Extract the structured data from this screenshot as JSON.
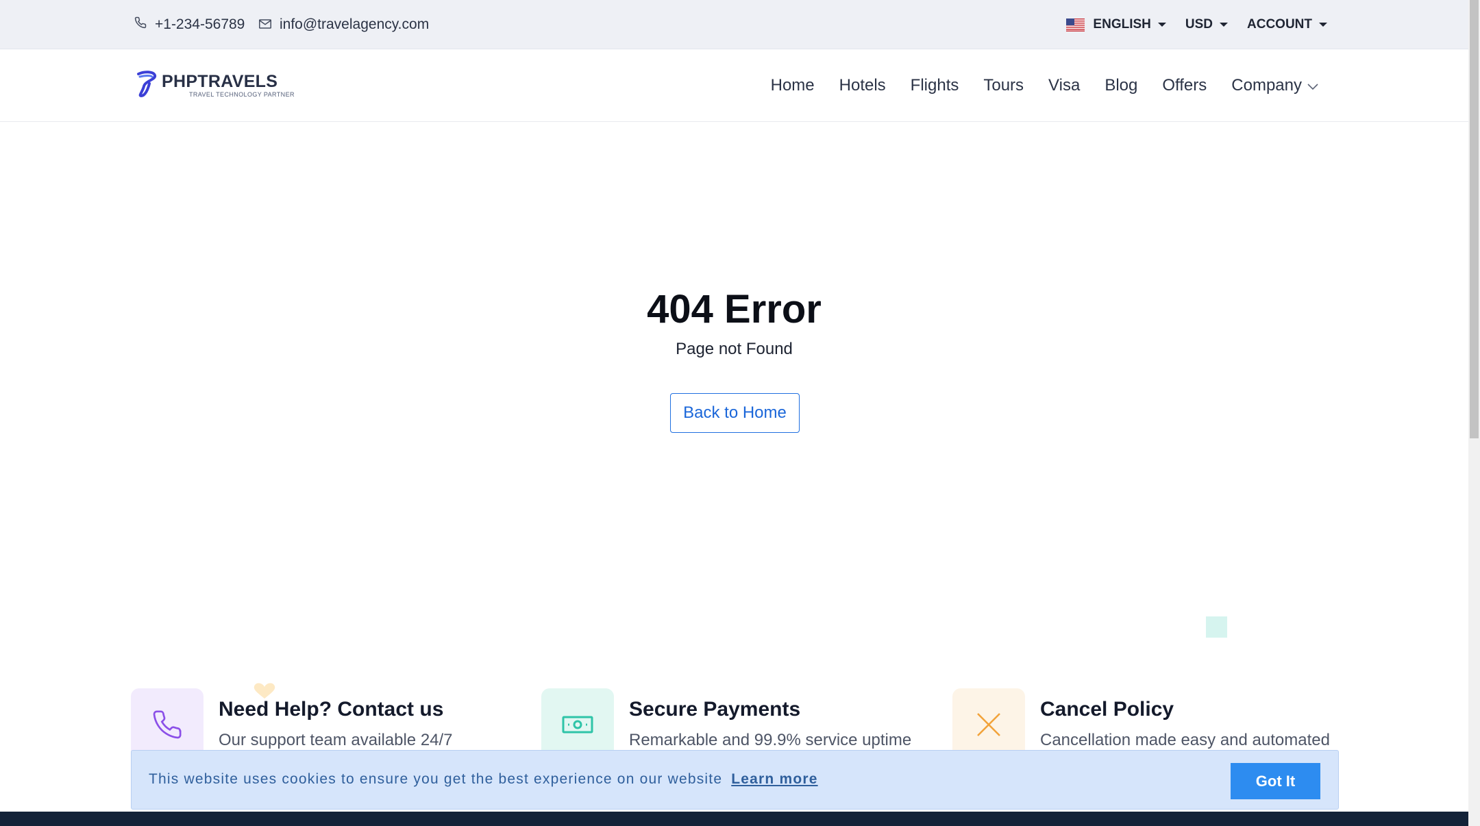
{
  "topbar": {
    "phone": "+1-234-56789",
    "email": "info@travelagency.com",
    "language": "ENGLISH",
    "currency": "USD",
    "account": "ACCOUNT"
  },
  "header": {
    "logo_name": "PHPTRAVELS",
    "logo_tagline": "TRAVEL TECHNOLOGY PARTNER",
    "nav": [
      "Home",
      "Hotels",
      "Flights",
      "Tours",
      "Visa",
      "Blog",
      "Offers",
      "Company"
    ]
  },
  "error": {
    "title": "404 Error",
    "subtitle": "Page not Found",
    "button": "Back to Home"
  },
  "features": [
    {
      "title": "Need Help? Contact us",
      "desc": "Our support team available 24/7",
      "icon": "phone-icon",
      "color": "#8b4fe8"
    },
    {
      "title": "Secure Payments",
      "desc": "Remarkable and 99.9% service uptime",
      "icon": "money-icon",
      "color": "#2fc4a8"
    },
    {
      "title": "Cancel Policy",
      "desc": "Cancellation made easy and automated",
      "icon": "close-icon",
      "color": "#f2a33a"
    }
  ],
  "cookie": {
    "text": "This website uses cookies to ensure you get the best experience on our website",
    "link": "Learn more",
    "button": "Got It"
  },
  "colors": {
    "accent": "#2d8cf0",
    "link": "#1a66d9",
    "footer": "#132238"
  }
}
